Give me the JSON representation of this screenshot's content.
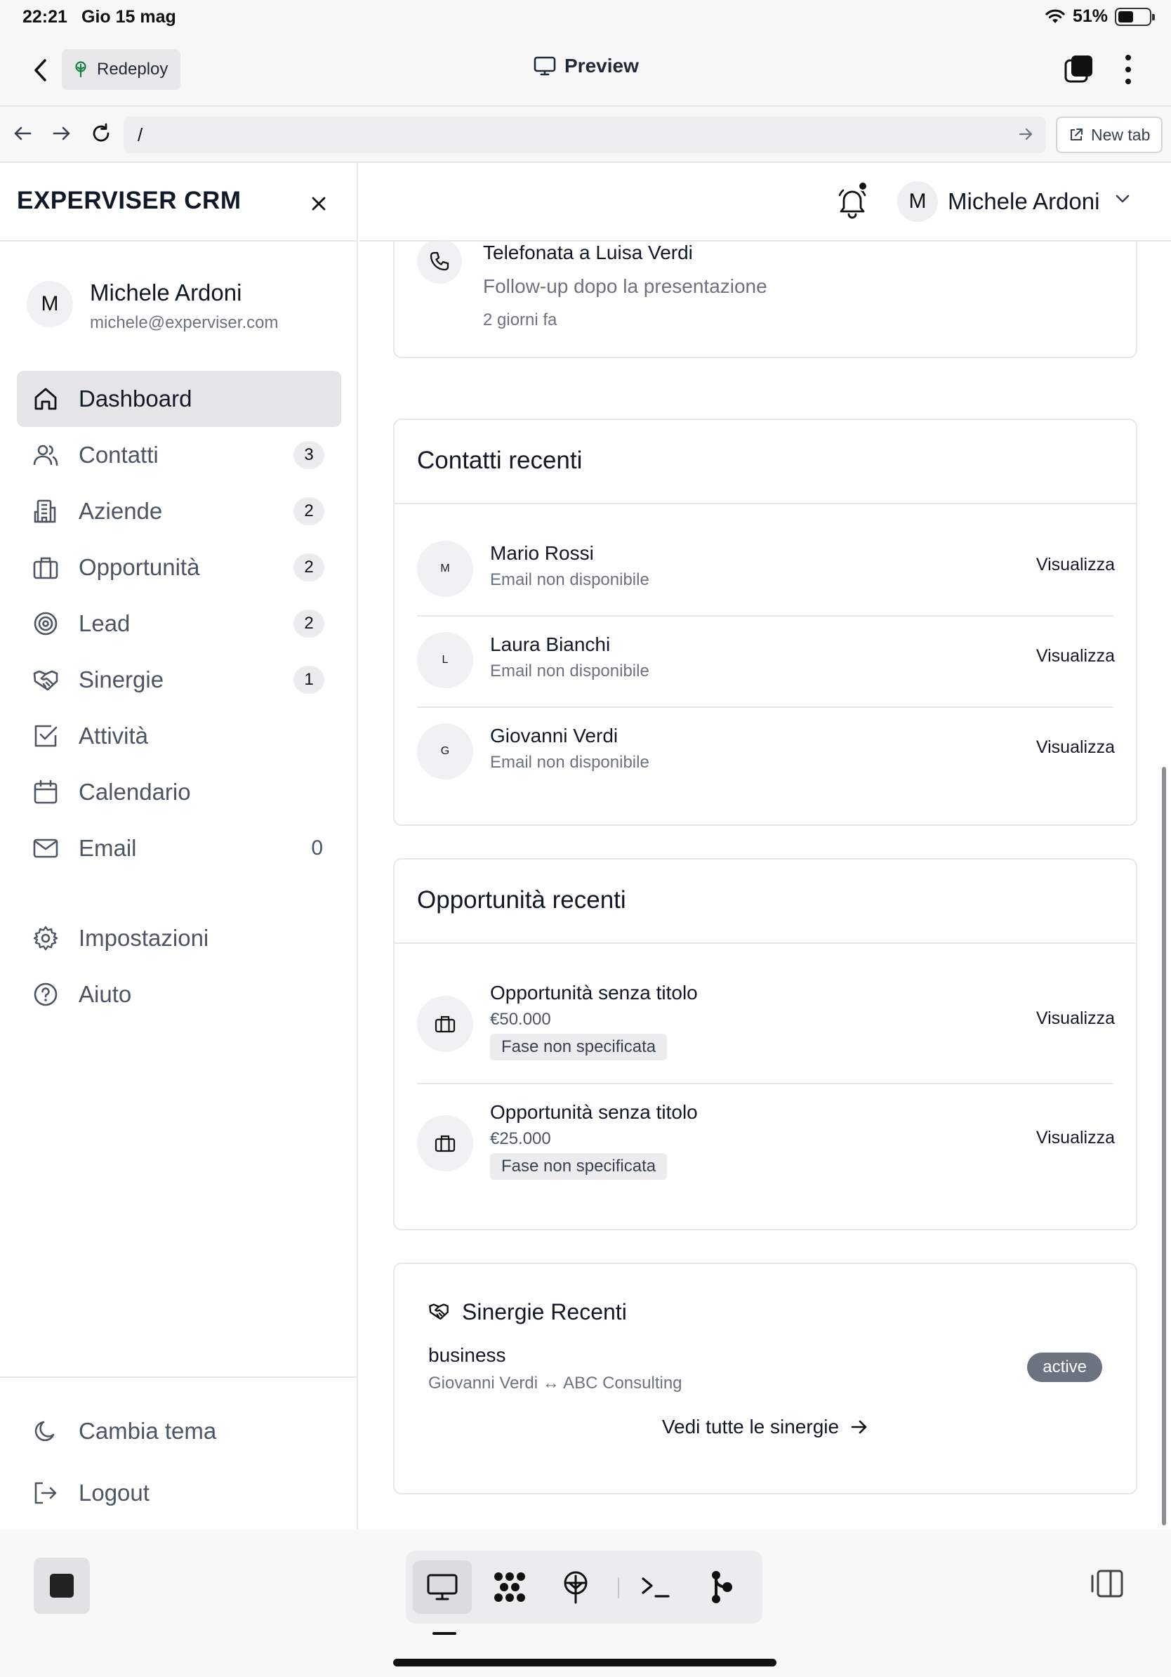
{
  "status_bar": {
    "time": "22:21",
    "date": "Gio 15 mag",
    "battery": "51%"
  },
  "app_bar": {
    "redeploy_label": "Redeploy",
    "preview_label": "Preview"
  },
  "url_bar": {
    "url": "/",
    "new_tab_label": "New tab"
  },
  "sidebar": {
    "brand": "EXPERVISER CRM",
    "user": {
      "initial": "M",
      "name": "Michele Ardoni",
      "email": "michele@experviser.com"
    },
    "items": [
      {
        "label": "Dashboard",
        "icon": "home-icon",
        "badge": null,
        "active": true
      },
      {
        "label": "Contatti",
        "icon": "users-icon",
        "badge": "3"
      },
      {
        "label": "Aziende",
        "icon": "building-icon",
        "badge": "2"
      },
      {
        "label": "Opportunità",
        "icon": "briefcase-icon",
        "badge": "2"
      },
      {
        "label": "Lead",
        "icon": "target-icon",
        "badge": "2"
      },
      {
        "label": "Sinergie",
        "icon": "handshake-icon",
        "badge": "1"
      },
      {
        "label": "Attività",
        "icon": "checkbox-icon",
        "badge": null
      },
      {
        "label": "Calendario",
        "icon": "calendar-icon",
        "badge": null
      },
      {
        "label": "Email",
        "icon": "mail-icon",
        "count": "0"
      }
    ],
    "secondary": [
      {
        "label": "Impostazioni",
        "icon": "gear-icon"
      },
      {
        "label": "Aiuto",
        "icon": "help-icon"
      }
    ],
    "footer": [
      {
        "label": "Cambia tema",
        "icon": "moon-icon"
      },
      {
        "label": "Logout",
        "icon": "logout-icon"
      }
    ]
  },
  "header": {
    "user_initial": "M",
    "user_name": "Michele Ardoni"
  },
  "activity": {
    "title": "Telefonata a Luisa Verdi",
    "description": "Follow-up dopo la presentazione",
    "time": "2 giorni fa"
  },
  "recent_contacts": {
    "title": "Contatti recenti",
    "view_label": "Visualizza",
    "items": [
      {
        "initial": "M",
        "name": "Mario Rossi",
        "email": "Email non disponibile"
      },
      {
        "initial": "L",
        "name": "Laura Bianchi",
        "email": "Email non disponibile"
      },
      {
        "initial": "G",
        "name": "Giovanni Verdi",
        "email": "Email non disponibile"
      }
    ]
  },
  "recent_opportunities": {
    "title": "Opportunità recenti",
    "view_label": "Visualizza",
    "items": [
      {
        "title": "Opportunità senza titolo",
        "amount": "€50.000",
        "stage": "Fase non specificata"
      },
      {
        "title": "Opportunità senza titolo",
        "amount": "€25.000",
        "stage": "Fase non specificata"
      }
    ]
  },
  "recent_synergies": {
    "title": "Sinergie Recenti",
    "item": {
      "name": "business",
      "parties": "Giovanni Verdi ↔ ABC Consulting",
      "status": "active"
    },
    "view_all_label": "Vedi tutte le sinergie"
  },
  "colors": {
    "accent": "#111827",
    "muted": "#6b7280",
    "border": "#e5e7eb",
    "badge_bg": "#ececef",
    "status_active": "#6b7280"
  }
}
